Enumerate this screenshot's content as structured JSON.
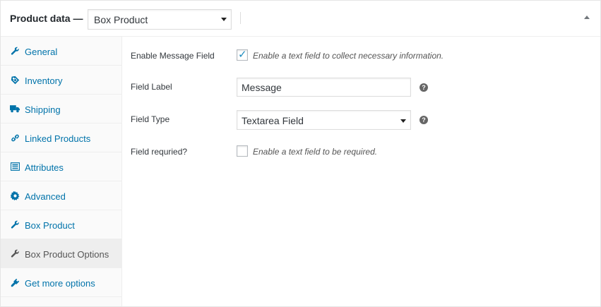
{
  "header": {
    "title": "Product data —",
    "product_type": "Box Product"
  },
  "sidebar": {
    "items": [
      {
        "label": "General",
        "icon": "wrench-icon"
      },
      {
        "label": "Inventory",
        "icon": "tag-icon"
      },
      {
        "label": "Shipping",
        "icon": "truck-icon"
      },
      {
        "label": "Linked Products",
        "icon": "link-icon"
      },
      {
        "label": "Attributes",
        "icon": "list-icon"
      },
      {
        "label": "Advanced",
        "icon": "gear-icon"
      },
      {
        "label": "Box Product",
        "icon": "wrench-icon"
      },
      {
        "label": "Box Product Options",
        "icon": "wrench-icon"
      },
      {
        "label": "Get more options",
        "icon": "plugin-icon"
      }
    ],
    "active": "Box Product Options"
  },
  "form": {
    "enable_message": {
      "label": "Enable Message Field",
      "checked": true,
      "description": "Enable a text field to collect necessary information."
    },
    "field_label": {
      "label": "Field Label",
      "value": "Message"
    },
    "field_type": {
      "label": "Field Type",
      "value": "Textarea Field"
    },
    "field_required": {
      "label": "Field requried?",
      "checked": false,
      "description": "Enable a text field to be required."
    },
    "help_glyph": "?"
  },
  "colors": {
    "link": "#0073aa",
    "active_tab_bg": "#eeeeee",
    "checkmark": "#1e8cbe"
  }
}
